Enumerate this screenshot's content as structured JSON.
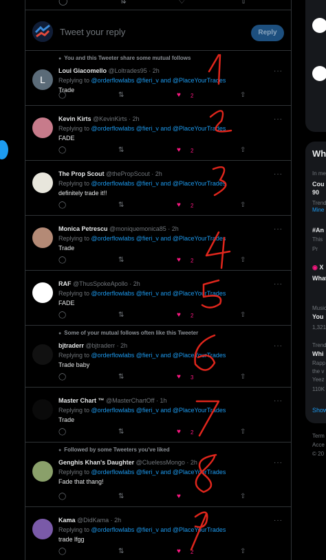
{
  "compose": {
    "placeholder": "Tweet your reply",
    "button": "Reply"
  },
  "tweets": [
    {
      "social": "You and this Tweeter share some mutual follows",
      "name": "Loui Giacomello",
      "handle": "@Loltrades95 · 2h",
      "replying": "Replying to",
      "mentions": "@orderflowlabs @fieri_v and @PlaceYourTrades",
      "text": "Trade",
      "likes": "2",
      "avatar_color": "#5b6b78",
      "avatar_letter": "L"
    },
    {
      "social": "",
      "name": "Kevin Kirts",
      "handle": "@KevinKirts · 2h",
      "replying": "Replying to",
      "mentions": "@orderflowlabs @fieri_v and @PlaceYourTrades",
      "text": "FADE",
      "likes": "2",
      "avatar_color": "#c77b8b",
      "avatar_letter": ""
    },
    {
      "social": "",
      "name": "The Prop Scout",
      "handle": "@thePropScout · 2h",
      "replying": "Replying to",
      "mentions": "@orderflowlabs @fieri_v and @PlaceYourTrades",
      "text": "definitely trade it!!",
      "likes": "2",
      "avatar_color": "#e8e6dc",
      "avatar_letter": ""
    },
    {
      "social": "",
      "name": "Monica Petrescu",
      "handle": "@moniquemonica85 · 2h",
      "replying": "Replying to",
      "mentions": "@orderflowlabs @fieri_v and @PlaceYourTrades",
      "text": "Trade",
      "likes": "2",
      "avatar_color": "#b48a76",
      "avatar_letter": ""
    },
    {
      "social": "",
      "name": "RAF",
      "handle": "@ThusSpokeApollo · 2h",
      "replying": "Replying to",
      "mentions": "@orderflowlabs @fieri_v and @PlaceYourTrades",
      "text": "FADE",
      "likes": "2",
      "avatar_color": "#ffffff",
      "avatar_letter": ""
    },
    {
      "social": "Some of your mutual follows often like this Tweeter",
      "name": "bjtraderr",
      "handle": "@bjtraderr · 2h",
      "replying": "Replying to",
      "mentions": "@orderflowlabs @fieri_v and @PlaceYourTrades",
      "text": "Trade baby",
      "likes": "3",
      "avatar_color": "#111111",
      "avatar_letter": ""
    },
    {
      "social": "",
      "name": "Master Chart ™",
      "handle": "@MasterChartOff · 1h",
      "replying": "Replying to",
      "mentions": "@orderflowlabs @fieri_v and @PlaceYourTrades",
      "text": "Trade",
      "likes": "2",
      "avatar_color": "#0a0a0a",
      "avatar_letter": ""
    },
    {
      "social": "Followed by some Tweeters you've liked",
      "name": "Genghis Khan's Daughter",
      "handle": "@CluelessMongo · 2h",
      "replying": "Replying to",
      "mentions": "@orderflowlabs @fieri_v and @PlaceYourTrades",
      "text": "Fade that thang!",
      "likes": "",
      "avatar_color": "#8aa06a",
      "avatar_letter": ""
    },
    {
      "social": "",
      "name": "Kama",
      "handle": "@DidKama · 2h",
      "replying": "Replying to",
      "mentions": "@orderflowlabs @fieri_v and @PlaceYourTrades",
      "text": "trade lfgg",
      "likes": "2",
      "avatar_color": "#7a5aa8",
      "avatar_letter": ""
    }
  ],
  "right": {
    "wh": "Wh",
    "in_me": "In me",
    "cou": "Cou",
    "ninety": "90",
    "trend": "Trend",
    "mine": "Mine",
    "hash_an": "#An",
    "this": "This",
    "pr": "Pr",
    "x": "X",
    "what": "What",
    "music": "Music",
    "you": "You",
    "n1321": "1,321",
    "trend2": "Trend",
    "whi": "Whi",
    "rapp": "Rapp",
    "the": "the v",
    "yeez": "Yeez",
    "k110": "110K",
    "show": "Show",
    "term": "Term",
    "acce": "Acce",
    "c20": "© 20"
  },
  "annotations": [
    "1",
    "2",
    "3",
    "4",
    "5",
    "6",
    "7",
    "8",
    "9"
  ],
  "colors": {
    "like": "#f91880",
    "link": "#1d9bf0",
    "annotation": "#e0261c"
  }
}
